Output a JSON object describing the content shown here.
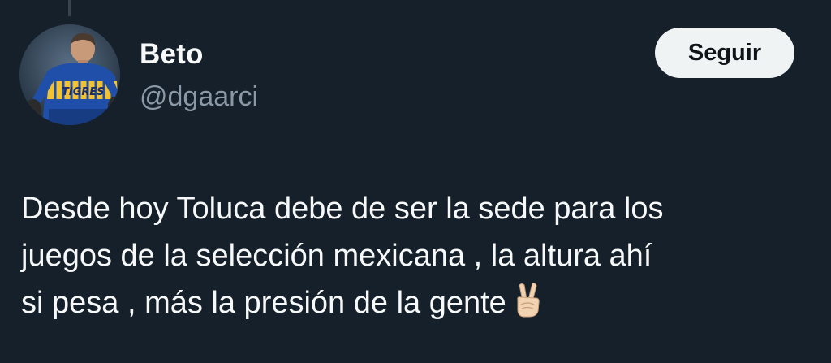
{
  "author": {
    "display_name": "Beto",
    "handle": "@dgaarci",
    "avatar_jersey_text": "TIGRES"
  },
  "actions": {
    "follow_label": "Seguir"
  },
  "tweet": {
    "lines": [
      "Desde hoy Toluca debe de ser la sede para los",
      "juegos de la selección mexicana , la altura ahí",
      "si pesa , más la presión de la gente"
    ],
    "emoji": "victory-hand"
  },
  "colors": {
    "background": "#15202b",
    "text_primary": "#f7f9f9",
    "text_secondary": "#8b98a5",
    "button_background": "#eff3f4",
    "button_text": "#0f1419"
  }
}
